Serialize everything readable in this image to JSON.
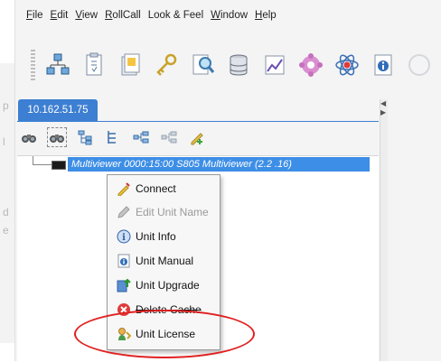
{
  "menubar": {
    "items": [
      {
        "letter": "F",
        "rest": "ile"
      },
      {
        "letter": "E",
        "rest": "dit"
      },
      {
        "letter": "V",
        "rest": "iew"
      },
      {
        "letter": "R",
        "rest": "ollCall"
      },
      {
        "letter": "",
        "rest": "Look & Feel"
      },
      {
        "letter": "W",
        "rest": "indow"
      },
      {
        "letter": "H",
        "rest": "elp"
      }
    ]
  },
  "toolbar": {
    "icons": [
      "network-icon",
      "clipboard-icon",
      "notes-icon",
      "keys-icon",
      "search-doc-icon",
      "database-icon",
      "graph-icon",
      "gear-flower-icon",
      "atom-icon",
      "info-doc-icon"
    ]
  },
  "panel": {
    "tab_label": "10.162.51.75",
    "tree_row_label": "Multiviewer 0000:15:00 S805 Multiviewer (2.2 .16)"
  },
  "context_menu": {
    "items": [
      {
        "label": "Connect",
        "icon": "connect-icon",
        "enabled": true
      },
      {
        "label": "Edit Unit Name",
        "icon": "pencil-icon",
        "enabled": false
      },
      {
        "label": "Unit Info",
        "icon": "info-icon",
        "enabled": true
      },
      {
        "label": "Unit Manual",
        "icon": "manual-icon",
        "enabled": true
      },
      {
        "label": "Unit Upgrade",
        "icon": "upgrade-icon",
        "enabled": true
      },
      {
        "label": "Delete Cache",
        "icon": "delete-icon",
        "enabled": true
      },
      {
        "label": "Unit License",
        "icon": "license-icon",
        "enabled": true
      }
    ]
  },
  "colors": {
    "selection": "#3d8ee6",
    "tab": "#3d7fd2",
    "annotation": "#e02020"
  },
  "bg_window_letters": [
    "p",
    "l",
    "d",
    "e"
  ]
}
